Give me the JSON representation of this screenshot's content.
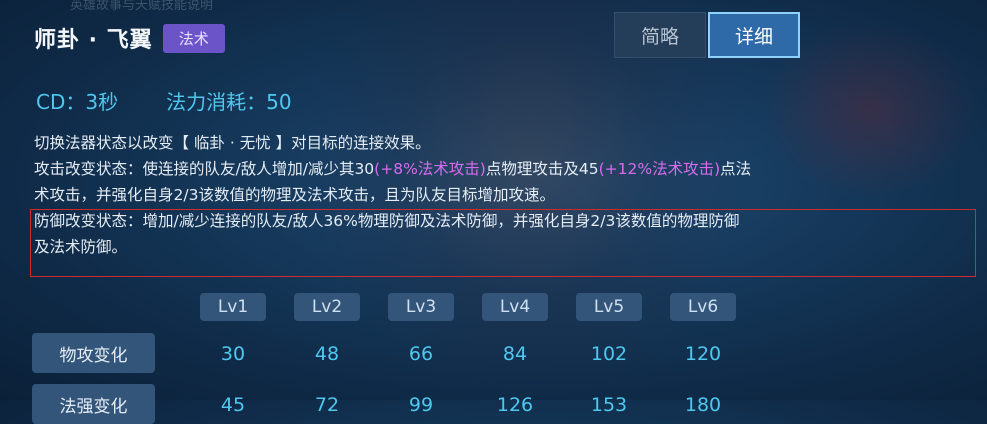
{
  "header": {
    "faded_text": "英雄故事与天赋技能说明",
    "skill_name": "师卦 · 飞翼",
    "skill_type": "法术"
  },
  "mode_toggle": {
    "brief_label": "简略",
    "detail_label": "详细",
    "selected": "详细"
  },
  "stats": {
    "cd": "CD：3秒",
    "mana": "法力消耗：50"
  },
  "description": {
    "line1": "切换法器状态以改变【 临卦 · 无忧 】对目标的连接效果。",
    "line2_a": "攻击改变状态：使连接的队友/敌人增加/减少其30",
    "line2_hl1": "(+8%法术攻击)",
    "line2_b": "点物理攻击及45",
    "line2_hl2": "(+12%法术攻击)",
    "line2_c": "点法",
    "line3": "术攻击，并强化自身2/3该数值的物理及法术攻击，且为队友目标增加攻速。",
    "line4": "防御改变状态：增加/减少连接的队友/敌人36%物理防御及法术防御，并强化自身2/3该数值的物理防御",
    "line5": "及法术防御。",
    "highlight_color": "#d56cf0"
  },
  "level_table": {
    "levels": [
      "Lv1",
      "Lv2",
      "Lv3",
      "Lv4",
      "Lv5",
      "Lv6"
    ],
    "rows": [
      {
        "label": "物攻变化",
        "values": [
          "30",
          "48",
          "66",
          "84",
          "102",
          "120"
        ]
      },
      {
        "label": "法强变化",
        "values": [
          "45",
          "72",
          "99",
          "126",
          "153",
          "180"
        ]
      }
    ]
  }
}
